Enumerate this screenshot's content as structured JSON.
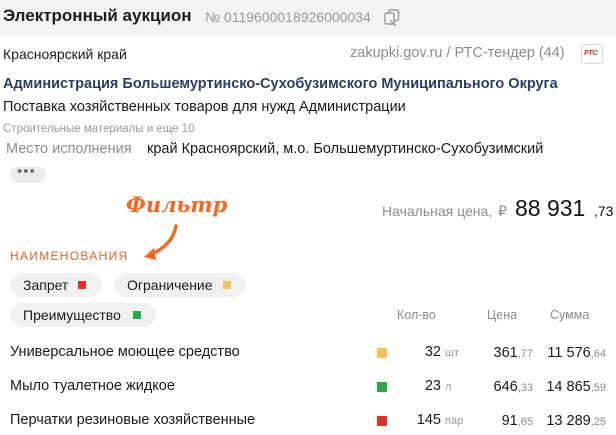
{
  "header": {
    "title": "Электронный аукцион",
    "number": "№ 0119600018926000034"
  },
  "card": {
    "region": "Красноярский край",
    "source": "zakupki.gov.ru / РТС-тендер (44)",
    "source_logo": "РТС",
    "organization": "Администрация Большемуртинско-Сухобузимского Муниципального Округа",
    "subject": "Поставка хозяйственных товаров для нужд Администрации",
    "categories": "Строительные материалы и еще 10",
    "place_label": "Место исполнения",
    "place_value": "край Красноярский, м.о. Большемуртинско-Сухобузимский",
    "more": "•••"
  },
  "annotation": {
    "text": "Фильтр",
    "color": "#f06a26"
  },
  "price": {
    "label": "Начальная цена,",
    "currency": "₽",
    "main": "88 931",
    "kop": ",73"
  },
  "items_section": {
    "label": "НАИМЕНОВАНИЯ",
    "filters": [
      {
        "label": "Запрет",
        "color": "#d9342b"
      },
      {
        "label": "Ограничение",
        "color": "#f1c35a"
      },
      {
        "label": "Преимущество",
        "color": "#2aa849"
      }
    ],
    "columns": {
      "qty": "Кол-во",
      "price": "Цена",
      "sum": "Сумма"
    },
    "rows": [
      {
        "name": "Универсальное моющее средство",
        "marker": "#f1c35a",
        "qty": "32",
        "unit": "шт",
        "price_int": "361",
        "price_dec": ",77",
        "sum_int": "11 576",
        "sum_dec": ",64"
      },
      {
        "name": "Мыло туалетное жидкое",
        "marker": "#2aa849",
        "qty": "23",
        "unit": "л",
        "price_int": "646",
        "price_dec": ",33",
        "sum_int": "14 865",
        "sum_dec": ",59"
      },
      {
        "name": "Перчатки резиновые хозяйственные",
        "marker": "#d9342b",
        "qty": "145",
        "unit": "пар",
        "price_int": "91",
        "price_dec": ",65",
        "sum_int": "13 289",
        "sum_dec": ",25"
      }
    ]
  },
  "icons": {
    "copy": "copy-icon"
  }
}
